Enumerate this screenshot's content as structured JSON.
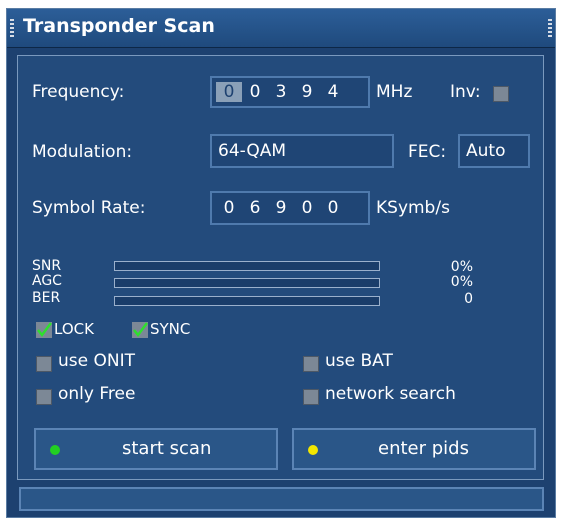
{
  "window": {
    "title": "Transponder Scan"
  },
  "frequency": {
    "label": "Frequency:",
    "digits": [
      "0",
      "0",
      "3",
      "9",
      "4"
    ],
    "unit": "MHz"
  },
  "inversion": {
    "label": "Inv:"
  },
  "modulation": {
    "label": "Modulation:",
    "value": "64-QAM"
  },
  "fec": {
    "label": "FEC:",
    "value": "Auto"
  },
  "symbol_rate": {
    "label": "Symbol Rate:",
    "digits": [
      "0",
      "6",
      "9",
      "0",
      "0"
    ],
    "unit": "KSymb/s"
  },
  "signal": {
    "snr": {
      "label": "SNR",
      "value": "0%",
      "level": 0
    },
    "agc": {
      "label": "AGC",
      "value": "0%",
      "level": 0
    },
    "ber": {
      "label": "BER",
      "value": "0",
      "level": 0
    }
  },
  "lock": {
    "label": "LOCK",
    "checked": true
  },
  "sync": {
    "label": "SYNC",
    "checked": true
  },
  "options": {
    "use_onit": {
      "label": "use ONIT",
      "checked": false
    },
    "use_bat": {
      "label": "use BAT",
      "checked": false
    },
    "only_free": {
      "label": "only Free",
      "checked": false
    },
    "network_search": {
      "label": "network search",
      "checked": false
    }
  },
  "buttons": {
    "start_scan": {
      "label": "start scan",
      "color": "#22d022"
    },
    "enter_pids": {
      "label": "enter pids",
      "color": "#f2e600"
    }
  },
  "colors": {
    "background": "#1d4170",
    "panel": "#234b7c",
    "accent": "#5b84b5"
  }
}
